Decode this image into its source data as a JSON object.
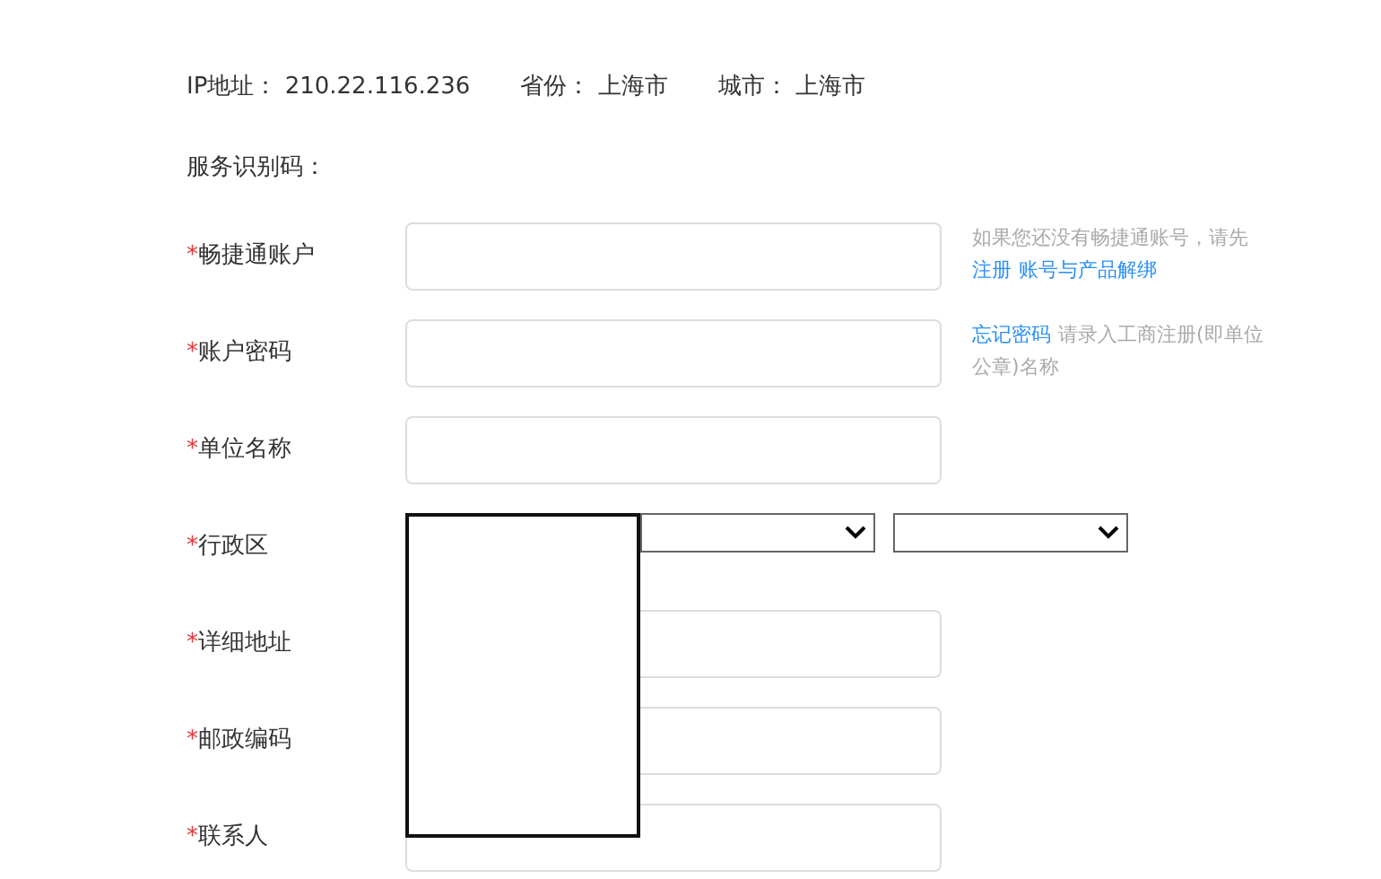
{
  "info": [
    {
      "label": "IP地址：",
      "value": "210.22.116.236"
    },
    {
      "label": "省份：",
      "value": "上海市"
    },
    {
      "label": "城市：",
      "value": "上海市"
    }
  ],
  "section_title": "服务识别码：",
  "fields": [
    {
      "kind": "input",
      "mark": "*",
      "label": "畅捷通账户",
      "hint": [
        {
          "kind": "text",
          "text": "如果您还没有畅捷通账号，请先"
        },
        {
          "kind": "link",
          "text": "注册"
        },
        {
          "kind": "link",
          "text": "账号与产品解绑"
        }
      ]
    },
    {
      "kind": "input",
      "mark": "*",
      "label": "账户密码",
      "hint": [
        {
          "kind": "link",
          "text": "忘记密码"
        },
        {
          "kind": "text",
          "text": "请录入工商注册(即单位公章)名称"
        }
      ]
    },
    {
      "kind": "input",
      "mark": "*",
      "label": "单位名称"
    },
    {
      "kind": "select",
      "mark": "*",
      "label": "行政区",
      "selects": [
        {
          "kind": "dropdown"
        },
        {
          "kind": "dropdown"
        }
      ],
      "dropdown_open": true
    },
    {
      "kind": "input",
      "mark": "*",
      "label": "详细地址"
    },
    {
      "kind": "input",
      "mark": "*",
      "label": "邮政编码"
    },
    {
      "kind": "input",
      "mark": "*",
      "label": "联系人"
    }
  ]
}
